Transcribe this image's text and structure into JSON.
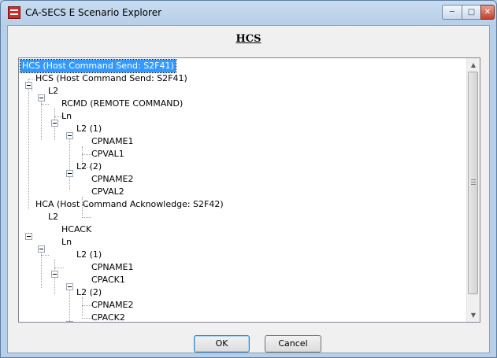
{
  "window": {
    "title": "CA-SECS E Scenario Explorer"
  },
  "heading": "HCS",
  "tree": {
    "nodes": [
      "HCS (Host Command Send: S2F41)",
      "HCS (Host Command Send: S2F41)",
      "L2",
      "RCMD (REMOTE COMMAND)",
      "Ln",
      "L2 (1)",
      "CPNAME1",
      "CPVAL1",
      "L2 (2)",
      "CPNAME2",
      "CPVAL2",
      "HCA (Host Command Acknowledge: S2F42)",
      "L2",
      "HCACK",
      "Ln",
      "L2 (1)",
      "CPNAME1",
      "CPACK1",
      "L2 (2)",
      "CPNAME2",
      "CPACK2"
    ]
  },
  "buttons": {
    "ok": "OK",
    "cancel": "Cancel"
  }
}
